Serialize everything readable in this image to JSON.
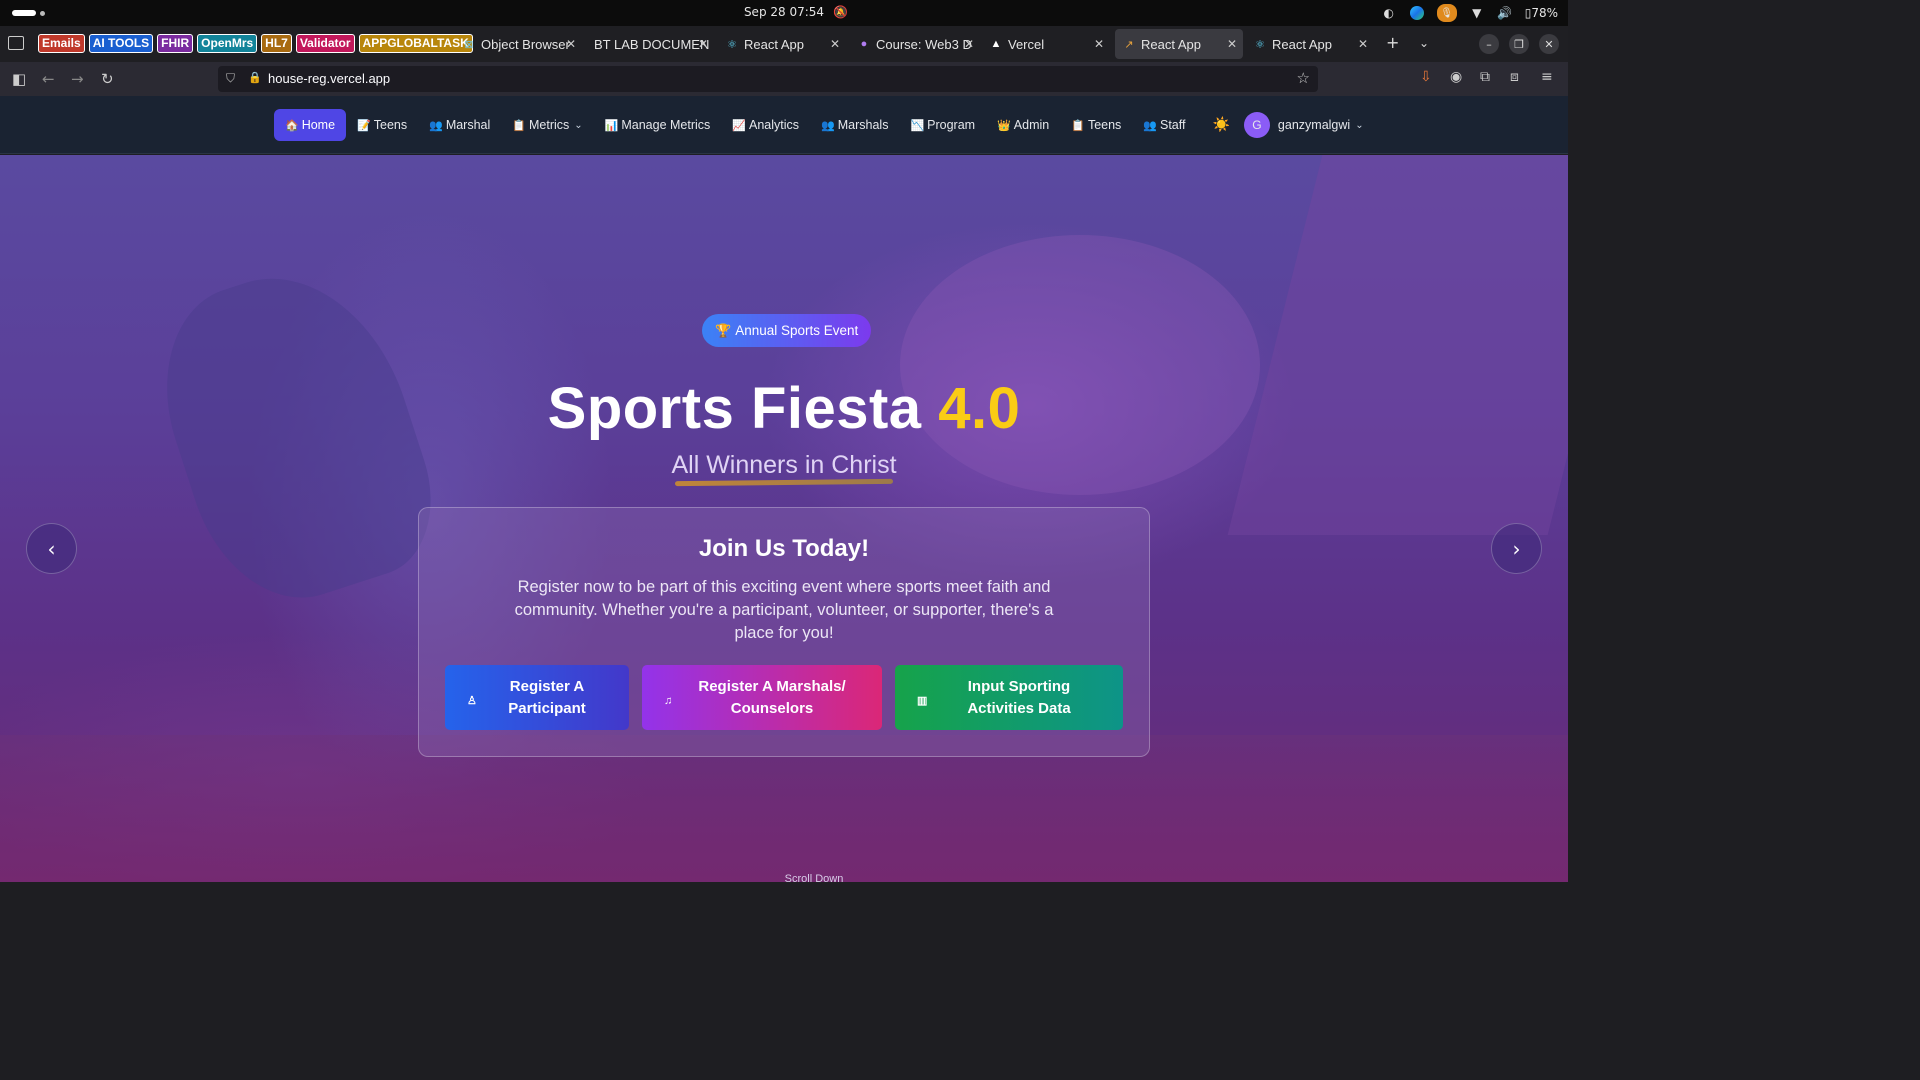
{
  "os": {
    "datetime": "Sep 28  07:54",
    "battery": "78%"
  },
  "browser": {
    "pinned": [
      {
        "label": "Emails",
        "color": "#c0392b"
      },
      {
        "label": "AI TOOLS",
        "color": "#1a5fd0"
      },
      {
        "label": "FHIR",
        "color": "#7b2ba0"
      },
      {
        "label": "OpenMrs",
        "color": "#12849a"
      },
      {
        "label": "HL7",
        "color": "#a86a10"
      },
      {
        "label": "Validator",
        "color": "#c2185b"
      },
      {
        "label": "APPGLOBALTASK",
        "color": "#b8860b"
      }
    ],
    "tabs": [
      {
        "title": "Object Browser",
        "icon": "object-browser-icon"
      },
      {
        "title": "BT LAB DOCUMEN",
        "icon": "none"
      },
      {
        "title": "React App",
        "icon": "react-icon"
      },
      {
        "title": "Course: Web3 D",
        "icon": "course-icon"
      },
      {
        "title": "Vercel",
        "icon": "vercel-icon"
      },
      {
        "title": "React App",
        "icon": "react-app-active-icon",
        "active": true
      },
      {
        "title": "React App",
        "icon": "react-icon"
      }
    ],
    "url": "house-reg.vercel.app"
  },
  "app_nav": {
    "items": [
      {
        "label": "Home",
        "emoji": "🏠",
        "active": true
      },
      {
        "label": "Teens",
        "emoji": "📝"
      },
      {
        "label": "Marshal",
        "emoji": "👥"
      },
      {
        "label": "Metrics",
        "emoji": "📋",
        "dropdown": true
      },
      {
        "label": "Manage Metrics",
        "emoji": "📊"
      },
      {
        "label": "Analytics",
        "emoji": "📈"
      },
      {
        "label": "Marshals",
        "emoji": "👥"
      },
      {
        "label": "Program",
        "emoji": "📉"
      },
      {
        "label": "Admin",
        "emoji": "👑"
      },
      {
        "label": "Teens",
        "emoji": "📋"
      },
      {
        "label": "Staff",
        "emoji": "👥"
      }
    ],
    "theme_icon": "☀️",
    "user": {
      "initial": "G",
      "name": "ganzymalgwi"
    }
  },
  "hero": {
    "badge": "Annual Sports Event",
    "badge_emoji": "🏆",
    "title_main": "Sports Fiesta",
    "title_version": "4.0",
    "subtitle": "All Winners in Christ",
    "card_title": "Join Us Today!",
    "card_text": "Register now to be part of this exciting event where sports meet faith and community. Whether you're a participant, volunteer, or supporter, there's a place for you!",
    "buttons": [
      {
        "label": "Register A Participant",
        "icon": "user-icon"
      },
      {
        "label": "Register A Marshals/ Counselors",
        "icon": "bell-icon"
      },
      {
        "label": "Input Sporting Activities Data",
        "icon": "bar-chart-icon"
      }
    ],
    "scroll_hint": "Scroll Down"
  }
}
